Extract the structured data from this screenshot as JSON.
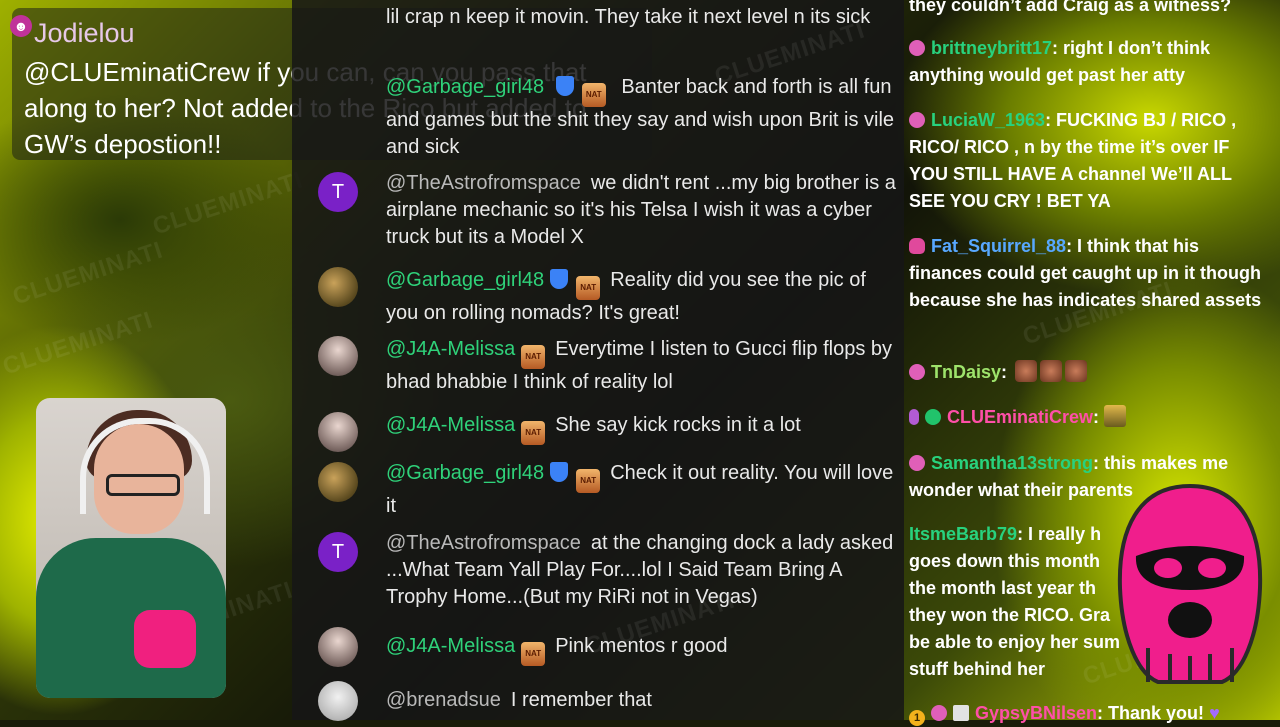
{
  "watermark": "CLUEMINATI",
  "featured": {
    "author": "Jodielou",
    "message": "@CLUEminatiCrew if you can, can you pass that along to her? Not added to the Rico but added to GW’s depostion!!"
  },
  "center_chat": {
    "messages": [
      {
        "text": "lil crap n keep it movin. They take it next level n its sick"
      },
      {
        "author": "@Garbage_girl48",
        "text": "Banter back and forth is all fun and games but the shit they say and wish upon Brit is vile and sick"
      },
      {
        "avatar": "T",
        "author": "@TheAstrofromspace",
        "text": "we didn't rent ...my big brother is a airplane mechanic so it's his Telsa I wish it was a cyber truck but its a Model X"
      },
      {
        "author": "@Garbage_girl48",
        "badge": "NAT ONE",
        "text": "Reality did you see the pic of you on rolling nomads? It's great!"
      },
      {
        "author": "@J4A-Melissa",
        "badge": "NAT ONE",
        "text": "Everytime I listen to Gucci flip flops by bhad bhabbie I think of reality lol"
      },
      {
        "author": "@J4A-Melissa",
        "badge": "NAT ONE",
        "text": "She say kick rocks in it a lot"
      },
      {
        "author": "@Garbage_girl48",
        "badge": "NAT ONE",
        "text": "Check it out reality. You will love it"
      },
      {
        "avatar": "T",
        "author": "@TheAstrofromspace",
        "text": "at the changing dock a lady asked ...What Team Yall Play For....lol I Said Team Bring A Trophy Home...(But my RiRi not in Vegas)"
      },
      {
        "author": "@J4A-Melissa",
        "badge": "NAT ONE",
        "text": "Pink mentos r good"
      },
      {
        "author": "@brenadsue",
        "text": "I remember that"
      }
    ]
  },
  "right_chat": {
    "messages": [
      {
        "text": "they couldn’t add Craig as a witness?"
      },
      {
        "author": "brittneybritt17",
        "text": ": right I don’t think anything would get past her atty"
      },
      {
        "author": "LuciaW_1963",
        "text": ": FUCKING BJ / RICO , RICO/ RICO , n by the time it’s over IF YOU STILL HAVE A channel We’ll ALL SEE YOU CRY ! BET YA"
      },
      {
        "author": "Fat_Squirrel_88",
        "text": ": I think that his finances could get caught up in it though because she has indicates shared assets"
      },
      {
        "author": "TnDaisy",
        "text": ":"
      },
      {
        "author": "CLUEminatiCrew",
        "text": ":"
      },
      {
        "author": "Samantha13strong",
        "text": ": this makes me wonder what their parents"
      },
      {
        "author": "ItsmeBarb79",
        "text": ": I really h",
        "lines": [
          "goes down this month",
          "the month last year th",
          "they won the RICO. Gra",
          "be able to enjoy her sum",
          "stuff behind her"
        ]
      },
      {
        "author": "GypsyBNilsen",
        "text": ": Thank you!"
      }
    ]
  },
  "colors": {
    "accent_pink": "#ff4fa8",
    "accent_green": "#2fd27a",
    "mention_blue": "#58a8ff",
    "chat_bg": "#161616"
  }
}
